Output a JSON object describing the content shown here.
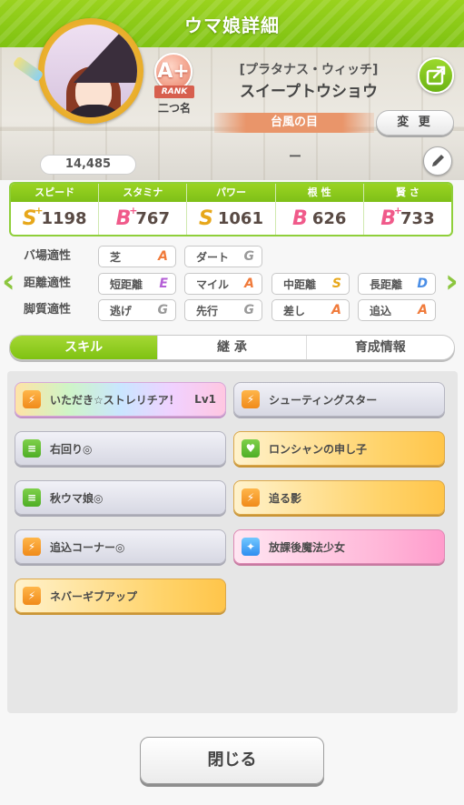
{
  "header": {
    "title": "ウマ娘詳細"
  },
  "profile": {
    "fans": "14,485",
    "rank": "A+",
    "rank_label": "RANK",
    "nickname": "二つ名",
    "outfit": "[プラタナス・ウィッチ]",
    "name": "スイープトウショウ",
    "title": "台風の目",
    "change_label": "変 更",
    "dash": "ー"
  },
  "stats": [
    {
      "label": "スピード",
      "grade": "S",
      "plus": "+",
      "value": "1198",
      "color": "#e7a71a"
    },
    {
      "label": "スタミナ",
      "grade": "B",
      "plus": "+",
      "value": "767",
      "color": "#f05a8a"
    },
    {
      "label": "パワー",
      "grade": "S",
      "plus": "",
      "value": "1061",
      "color": "#e7a71a"
    },
    {
      "label": "根 性",
      "grade": "B",
      "plus": "",
      "value": "626",
      "color": "#f05a8a"
    },
    {
      "label": "賢 さ",
      "grade": "B",
      "plus": "+",
      "value": "733",
      "color": "#f05a8a"
    }
  ],
  "aptitude": {
    "track": {
      "label": "バ場適性",
      "items": [
        {
          "name": "芝",
          "grade": "A",
          "color": "#f07a3a"
        },
        {
          "name": "ダート",
          "grade": "G",
          "color": "#9a9a9a"
        }
      ]
    },
    "distance": {
      "label": "距離適性",
      "items": [
        {
          "name": "短距離",
          "grade": "E",
          "color": "#b45fd6"
        },
        {
          "name": "マイル",
          "grade": "A",
          "color": "#f07a3a"
        },
        {
          "name": "中距離",
          "grade": "S",
          "color": "#e7a71a"
        },
        {
          "name": "長距離",
          "grade": "D",
          "color": "#4a8ee6"
        }
      ]
    },
    "style": {
      "label": "脚質適性",
      "items": [
        {
          "name": "逃げ",
          "grade": "G",
          "color": "#9a9a9a"
        },
        {
          "name": "先行",
          "grade": "G",
          "color": "#9a9a9a"
        },
        {
          "name": "差し",
          "grade": "A",
          "color": "#f07a3a"
        },
        {
          "name": "追込",
          "grade": "A",
          "color": "#f07a3a"
        }
      ]
    }
  },
  "tabs": [
    {
      "label": "スキル"
    },
    {
      "label": "継 承"
    },
    {
      "label": "育成情報"
    }
  ],
  "skills": [
    {
      "name": "いただき☆ストレリチア！",
      "level": "Lv1",
      "style": "rainbow",
      "icon": "running-figure-icon",
      "icon_class": "ic-orange"
    },
    {
      "name": "シューティングスター",
      "level": "",
      "style": "white",
      "icon": "running-figure-icon",
      "icon_class": "ic-orange"
    },
    {
      "name": "右回り◎",
      "level": "",
      "style": "white",
      "icon": "track-icon",
      "icon_class": "ic-green"
    },
    {
      "name": "ロンシャンの申し子",
      "level": "",
      "style": "gold",
      "icon": "heart-icon",
      "icon_class": "ic-green"
    },
    {
      "name": "秋ウマ娘◎",
      "level": "",
      "style": "white",
      "icon": "track-icon",
      "icon_class": "ic-green"
    },
    {
      "name": "追る影",
      "level": "",
      "style": "gold",
      "icon": "running-figure-icon",
      "icon_class": "ic-orange"
    },
    {
      "name": "追込コーナー◎",
      "level": "",
      "style": "white",
      "icon": "running-figure-icon",
      "icon_class": "ic-orange"
    },
    {
      "name": "放課後魔法少女",
      "level": "",
      "style": "pink",
      "icon": "sparkle-icon",
      "icon_class": "ic-blue"
    },
    {
      "name": "ネバーギブアップ",
      "level": "",
      "style": "gold",
      "icon": "running-figure-icon",
      "icon_class": "ic-orange"
    }
  ],
  "close_label": "閉じる"
}
